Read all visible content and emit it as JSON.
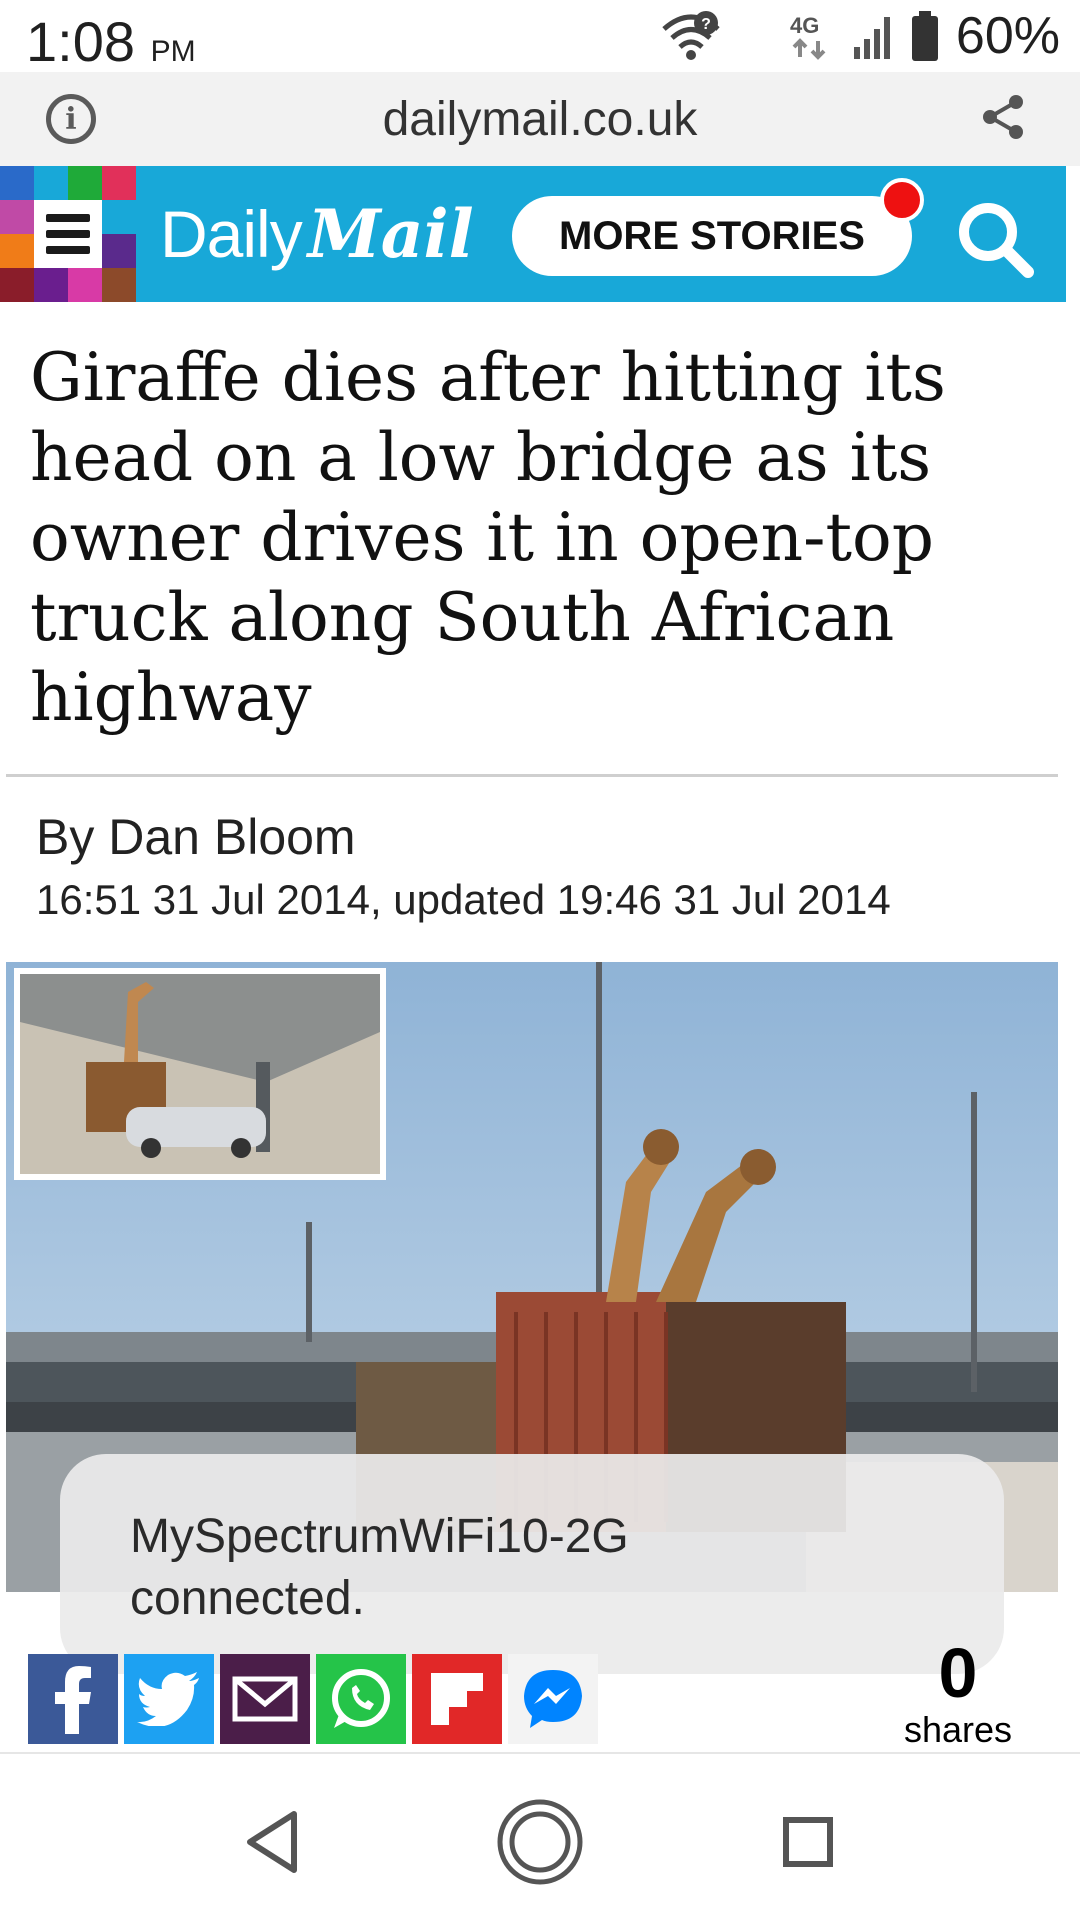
{
  "status_bar": {
    "time": "1:08",
    "time_suffix": "PM",
    "network": "4G",
    "battery": "60%",
    "icons": [
      "wifi-question-icon",
      "lte-icon",
      "signal-icon",
      "battery-icon"
    ]
  },
  "browser": {
    "url": "dailymail.co.uk",
    "info_icon": "info-icon",
    "share_icon": "share-icon"
  },
  "site_header": {
    "brand_part1": "Daily",
    "brand_part2": "Mail",
    "more_stories": "MORE STORIES",
    "colors": {
      "header_bg": "#18a8d8",
      "notification_dot": "#ee1111"
    }
  },
  "article": {
    "headline": "Giraffe dies after hitting its head on a low bridge as its owner drives it in open-top truck along South African highway",
    "byline": "By Dan Bloom",
    "dateline": "16:51 31 Jul 2014, updated 19:46 31 Jul 2014"
  },
  "toast": {
    "line1": "MySpectrumWiFi10-2G",
    "line2": "connected."
  },
  "share": {
    "buttons": [
      {
        "name": "facebook",
        "icon": "facebook-icon",
        "color": "#3b5998"
      },
      {
        "name": "twitter",
        "icon": "twitter-icon",
        "color": "#1da1f2"
      },
      {
        "name": "email",
        "icon": "email-icon",
        "color": "#4b1e49"
      },
      {
        "name": "whatsapp",
        "icon": "whatsapp-icon",
        "color": "#25c449"
      },
      {
        "name": "flipboard",
        "icon": "flipboard-icon",
        "color": "#e12828"
      },
      {
        "name": "messenger",
        "icon": "messenger-icon",
        "color": "#0084ff"
      }
    ],
    "count": "0",
    "count_label": "shares"
  },
  "nav_bar": {
    "back": "back-icon",
    "home": "home-icon",
    "recents": "recents-icon"
  }
}
